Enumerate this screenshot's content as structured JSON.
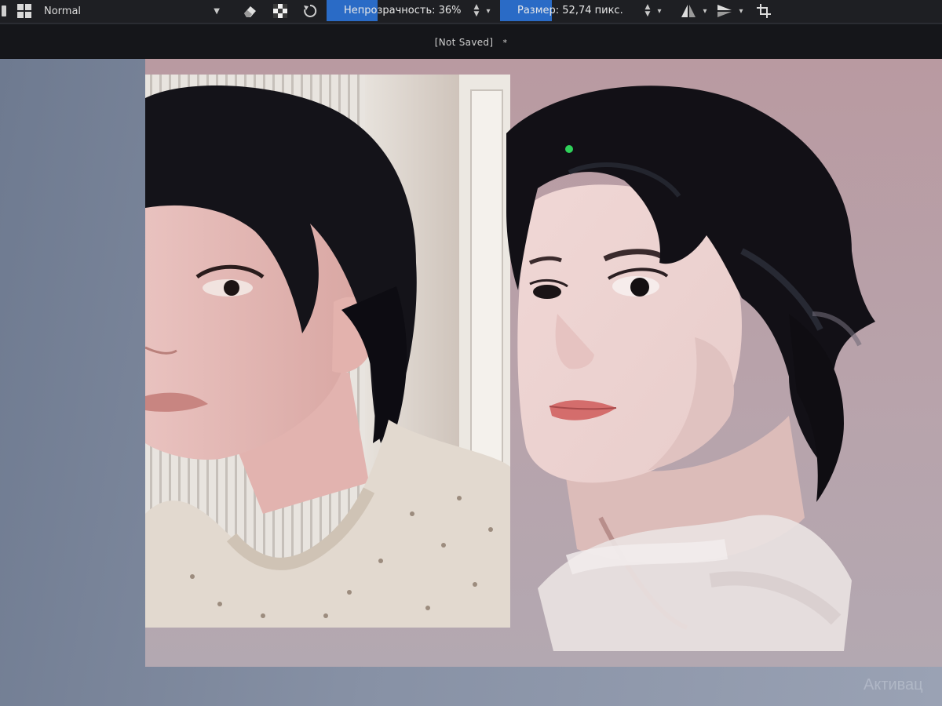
{
  "toolbar": {
    "blend_mode": "Normal",
    "opacity_label": "Непрозрачность: 36%",
    "opacity_value": 36,
    "size_label": "Размер: 52,74 пикс."
  },
  "document": {
    "title": "[Not Saved]",
    "modified_marker": "*"
  },
  "system": {
    "activation_watermark": "Активац"
  },
  "icons": {
    "presets": "brush-presets-icon",
    "blend": "dropdown-chevron-icon",
    "eraser": "eraser-icon",
    "alpha": "alpha-lock-icon",
    "reload": "reload-preset-icon",
    "mirror_h": "mirror-horizontal-icon",
    "mirror_v": "mirror-vertical-icon",
    "wrap": "wrap-around-icon"
  },
  "colors": {
    "accent": "#2a6bc6",
    "toolbar_bg": "#1e1f23",
    "canvas_bg": "#b99aa1"
  }
}
